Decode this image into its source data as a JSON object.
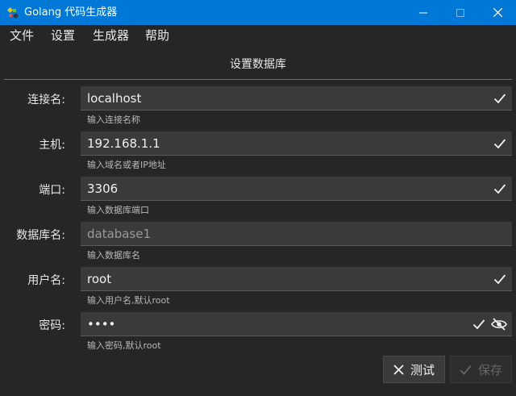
{
  "window": {
    "title": "Golang 代码生成器",
    "icon": "gopher-icon",
    "controls": [
      "minimize-icon",
      "maximize-icon",
      "close-icon"
    ],
    "accent_color": "#0078d7"
  },
  "menu": {
    "items": [
      {
        "label": "文件"
      },
      {
        "label": "设置"
      },
      {
        "label": "生成器"
      },
      {
        "label": "帮助"
      }
    ]
  },
  "form": {
    "title": "设置数据库",
    "fields": [
      {
        "label": "连接名:",
        "value": "localhost",
        "hint": "输入连接名称",
        "valid": true
      },
      {
        "label": "主机:",
        "value": "192.168.1.1",
        "hint": "输入域名或者IP地址",
        "valid": true
      },
      {
        "label": "端口:",
        "value": "3306",
        "hint": "输入数据库端口",
        "valid": true
      },
      {
        "label": "数据库名:",
        "placeholder": "database1",
        "hint": "输入数据库名",
        "valid": false
      },
      {
        "label": "用户名:",
        "value": "root",
        "hint": "输入用户名,默认root",
        "valid": true
      },
      {
        "label": "密码:",
        "value": "••••",
        "hint": "输入密码,默认root",
        "valid": true,
        "reveal_icon": "eye-off-icon"
      }
    ]
  },
  "buttons": {
    "test": {
      "label": "测试",
      "icon": "x-icon"
    },
    "save": {
      "label": "保存",
      "icon": "check-icon",
      "disabled": true
    }
  }
}
